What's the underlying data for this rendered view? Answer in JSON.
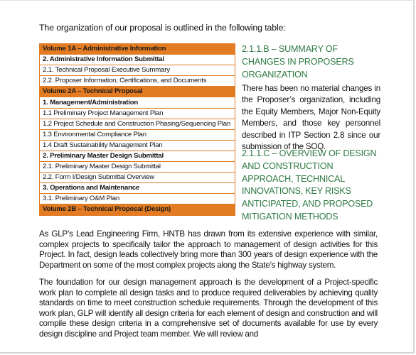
{
  "intro_text": "The organization of our proposal is outlined in the following table:",
  "table": {
    "rows": [
      {
        "text": "Volume 1A – Administrative Information",
        "style": "volume"
      },
      {
        "text": "2. Administrative Information Submittal",
        "style": "bold"
      },
      {
        "text": "2.1. Technical Proposal Executive Summary",
        "style": "normal"
      },
      {
        "text": "2.2. Proposer Information, Certifications, and Documents",
        "style": "normal"
      },
      {
        "text": "Volume 2A – Technical Proposal",
        "style": "volume"
      },
      {
        "text": "1. Management/Administration",
        "style": "bold"
      },
      {
        "text": "1.1 Preliminary Project Management Plan",
        "style": "normal"
      },
      {
        "text": "1.2 Project Schedule and Construction Phasing/Sequencing Plan",
        "style": "normal"
      },
      {
        "text": "1.3 Environmental Compliance Plan",
        "style": "normal"
      },
      {
        "text": "1.4 Draft Sustainability Management Plan",
        "style": "normal"
      },
      {
        "text": "2. Preliminary Master Design Submittal",
        "style": "bold"
      },
      {
        "text": "2.1. Preliminary Master Design Submittal",
        "style": "normal"
      },
      {
        "text": "2.2. Form I/Design Submittal Overview",
        "style": "normal"
      },
      {
        "text": "3. Operations and Maintenance",
        "style": "bold"
      },
      {
        "text": "3.1. Preliminary O&M Plan",
        "style": "normal"
      },
      {
        "text": "Volume 2B – Technical Proposal (Design)",
        "style": "volume"
      }
    ]
  },
  "section_b": {
    "heading": "2.1.1.B – SUMMARY OF CHANGES IN PROPOSERS ORGANIZATION",
    "body": "There has been no material changes in the Proposer’s organization, including the Equity Members, Major Non-Equity Members, and those key personnel described in ITP Section 2.8 since our submission of the SOQ."
  },
  "section_c": {
    "heading": "2.1.1.C – OVERVIEW OF DESIGN AND CONSTRUCTION APPROACH, TECHNICAL INNOVATIONS, KEY RISKS ANTICIPATED, AND PROPOSED MITIGATION METHODS"
  },
  "paragraphs": [
    "As GLP’s Lead Engineering Firm, HNTB has drawn from its extensive experience with similar, complex projects to specifically tailor the approach to management of design activities for this Project. In fact, design leads collectively bring more than 300 years of design experience with the Department on some of the most complex projects along the State’s highway system.",
    "The foundation for our design management approach is the development of a Project-specific work plan to complete all design tasks and to produce required deliverables by achieving quality standards on time to meet construction schedule requirements. Through the development of this work plan, GLP will identify all design criteria for each element of design and construction and will compile these design criteria in a comprehensive set of documents available for use by every design discipline and Project team member. We will review and"
  ],
  "colors": {
    "accent_orange": "#e27b22",
    "heading_green": "#2f7a43"
  }
}
